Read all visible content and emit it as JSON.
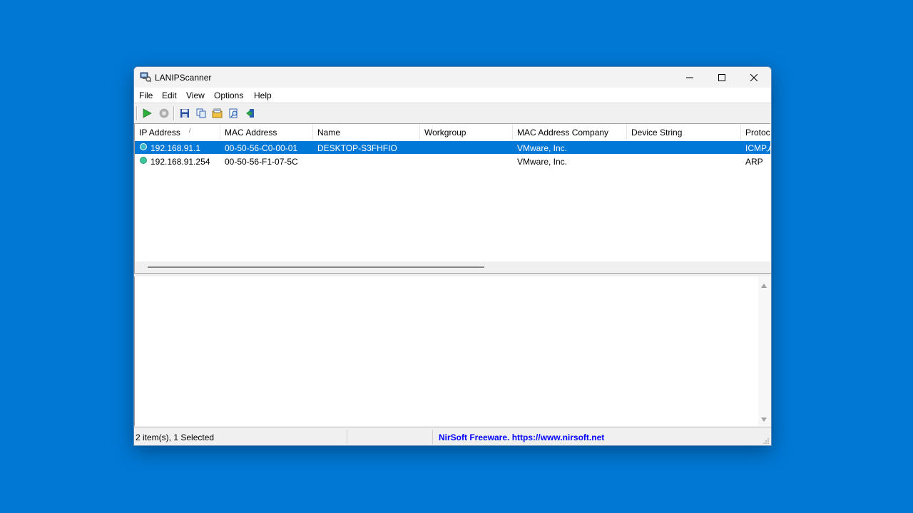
{
  "window": {
    "title": "LANIPScanner",
    "icon": "network-scanner-icon"
  },
  "menu": [
    "File",
    "Edit",
    "View",
    "Options",
    "Help"
  ],
  "toolbar": {
    "buttons": [
      "start-scan-icon",
      "stop-scan-icon",
      "save-icon",
      "copy-icon",
      "properties-icon",
      "find-icon",
      "exit-icon"
    ]
  },
  "table": {
    "columns": [
      "IP Address",
      "MAC Address",
      "Name",
      "Workgroup",
      "MAC Address Company",
      "Device String",
      "Protocol"
    ],
    "sort_indicator": "/",
    "rows": [
      {
        "ip": "192.168.91.1",
        "mac": "00-50-56-C0-00-01",
        "name": "DESKTOP-S3FHFIO",
        "workgroup": "",
        "company": "VMware, Inc.",
        "device": "",
        "protocol": "ICMP,A",
        "selected": true,
        "status_color": "#3cb8c8"
      },
      {
        "ip": "192.168.91.254",
        "mac": "00-50-56-F1-07-5C",
        "name": "",
        "workgroup": "",
        "company": "VMware, Inc.",
        "device": "",
        "protocol": "ARP",
        "selected": false,
        "status_color": "#3cc89c"
      }
    ]
  },
  "status": {
    "count": "2 item(s), 1 Selected",
    "middle": "",
    "link": "NirSoft Freeware. https://www.nirsoft.net"
  },
  "colors": {
    "desktop": "#0078d4",
    "selection": "#0078d7",
    "link": "#0000ff"
  }
}
